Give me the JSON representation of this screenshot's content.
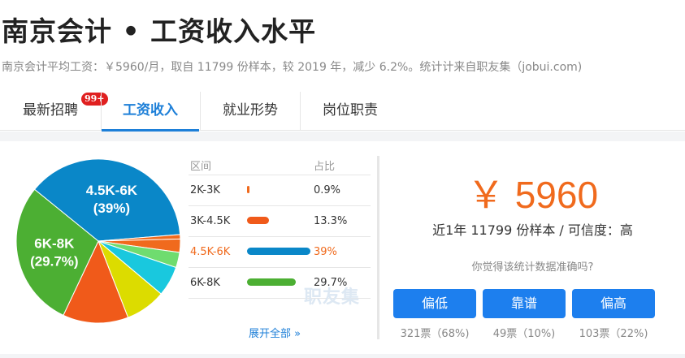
{
  "page": {
    "title": "南京会计 • 工资收入水平",
    "subtitle": "南京会计平均工资：￥5960/月，取自 11799 份样本，较 2019 年，减少 6.2%。统计计来自职友集（jobui.com)"
  },
  "tabs": [
    {
      "label": "最新招聘",
      "badge": "99+"
    },
    {
      "label": "工资收入",
      "active": true
    },
    {
      "label": "就业形势"
    },
    {
      "label": "岗位职责"
    }
  ],
  "distribution": {
    "header_range": "区间",
    "header_pct": "占比",
    "rows": [
      {
        "range": "2K-3K",
        "pct": "0.9%",
        "color": "#f06a1d"
      },
      {
        "range": "3K-4.5K",
        "pct": "13.3%",
        "color": "#f05a1a"
      },
      {
        "range": "4.5K-6K",
        "pct": "39%",
        "color": "#0a87c8"
      },
      {
        "range": "6K-8K",
        "pct": "29.7%",
        "color": "#4caf33"
      }
    ],
    "expand_label": "展开全部 »",
    "watermark": "职友集"
  },
  "chart_data": {
    "type": "pie",
    "slices": [
      {
        "label": "4.5K-6K",
        "label2": "(39%)",
        "value": 39,
        "color": "#0a87c8"
      },
      {
        "label": "",
        "value": 0.9,
        "color": "#f06a1d"
      },
      {
        "label": "",
        "value": 2.7,
        "color": "#f06a1d"
      },
      {
        "label": "",
        "value": 3.1,
        "color": "#6fdc6f"
      },
      {
        "label": "",
        "value": 6.1,
        "color": "#19c8de"
      },
      {
        "label": "",
        "value": 8.2,
        "color": "#dcdc00"
      },
      {
        "label": "",
        "value": 13.3,
        "color": "#f05a1a"
      },
      {
        "label": "6K-8K",
        "label2": "(29.7%)",
        "value": 29.7,
        "color": "#4caf33"
      }
    ]
  },
  "summary": {
    "salary": "￥ 5960",
    "sample_text": "近1年 11799 份样本 / 可信度：高",
    "question": "你觉得该统计数据准确吗?",
    "votes": [
      {
        "label": "偏低",
        "count": "321票（68%)"
      },
      {
        "label": "靠谱",
        "count": "49票（10%)"
      },
      {
        "label": "偏高",
        "count": "103票（22%)"
      }
    ],
    "button_color": "#1d7fee"
  }
}
